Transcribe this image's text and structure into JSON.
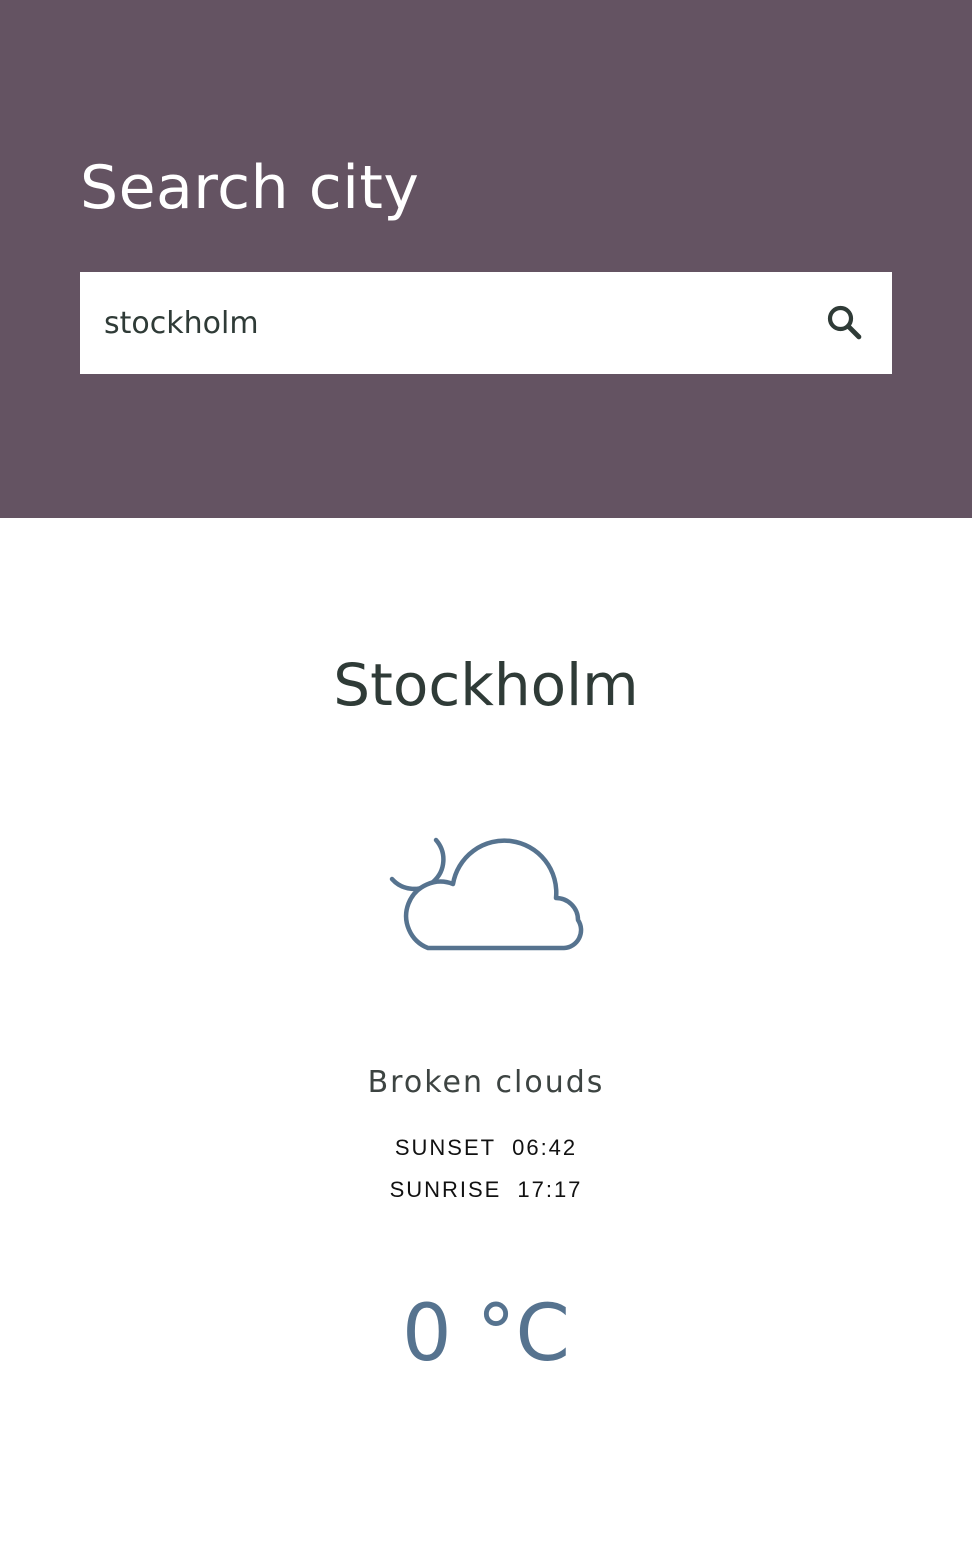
{
  "header": {
    "title": "Search city",
    "background_color": "#645362"
  },
  "search": {
    "value": "stockholm",
    "button_icon": "search-icon"
  },
  "weather": {
    "city": "Stockholm",
    "icon": "cloud-moon-icon",
    "description": "Broken clouds",
    "sunset_label": "SUNSET",
    "sunset_time": "06:42",
    "sunrise_label": "SUNRISE",
    "sunrise_time": "17:17",
    "temperature": "0 °C",
    "accent_color": "#56738f"
  }
}
